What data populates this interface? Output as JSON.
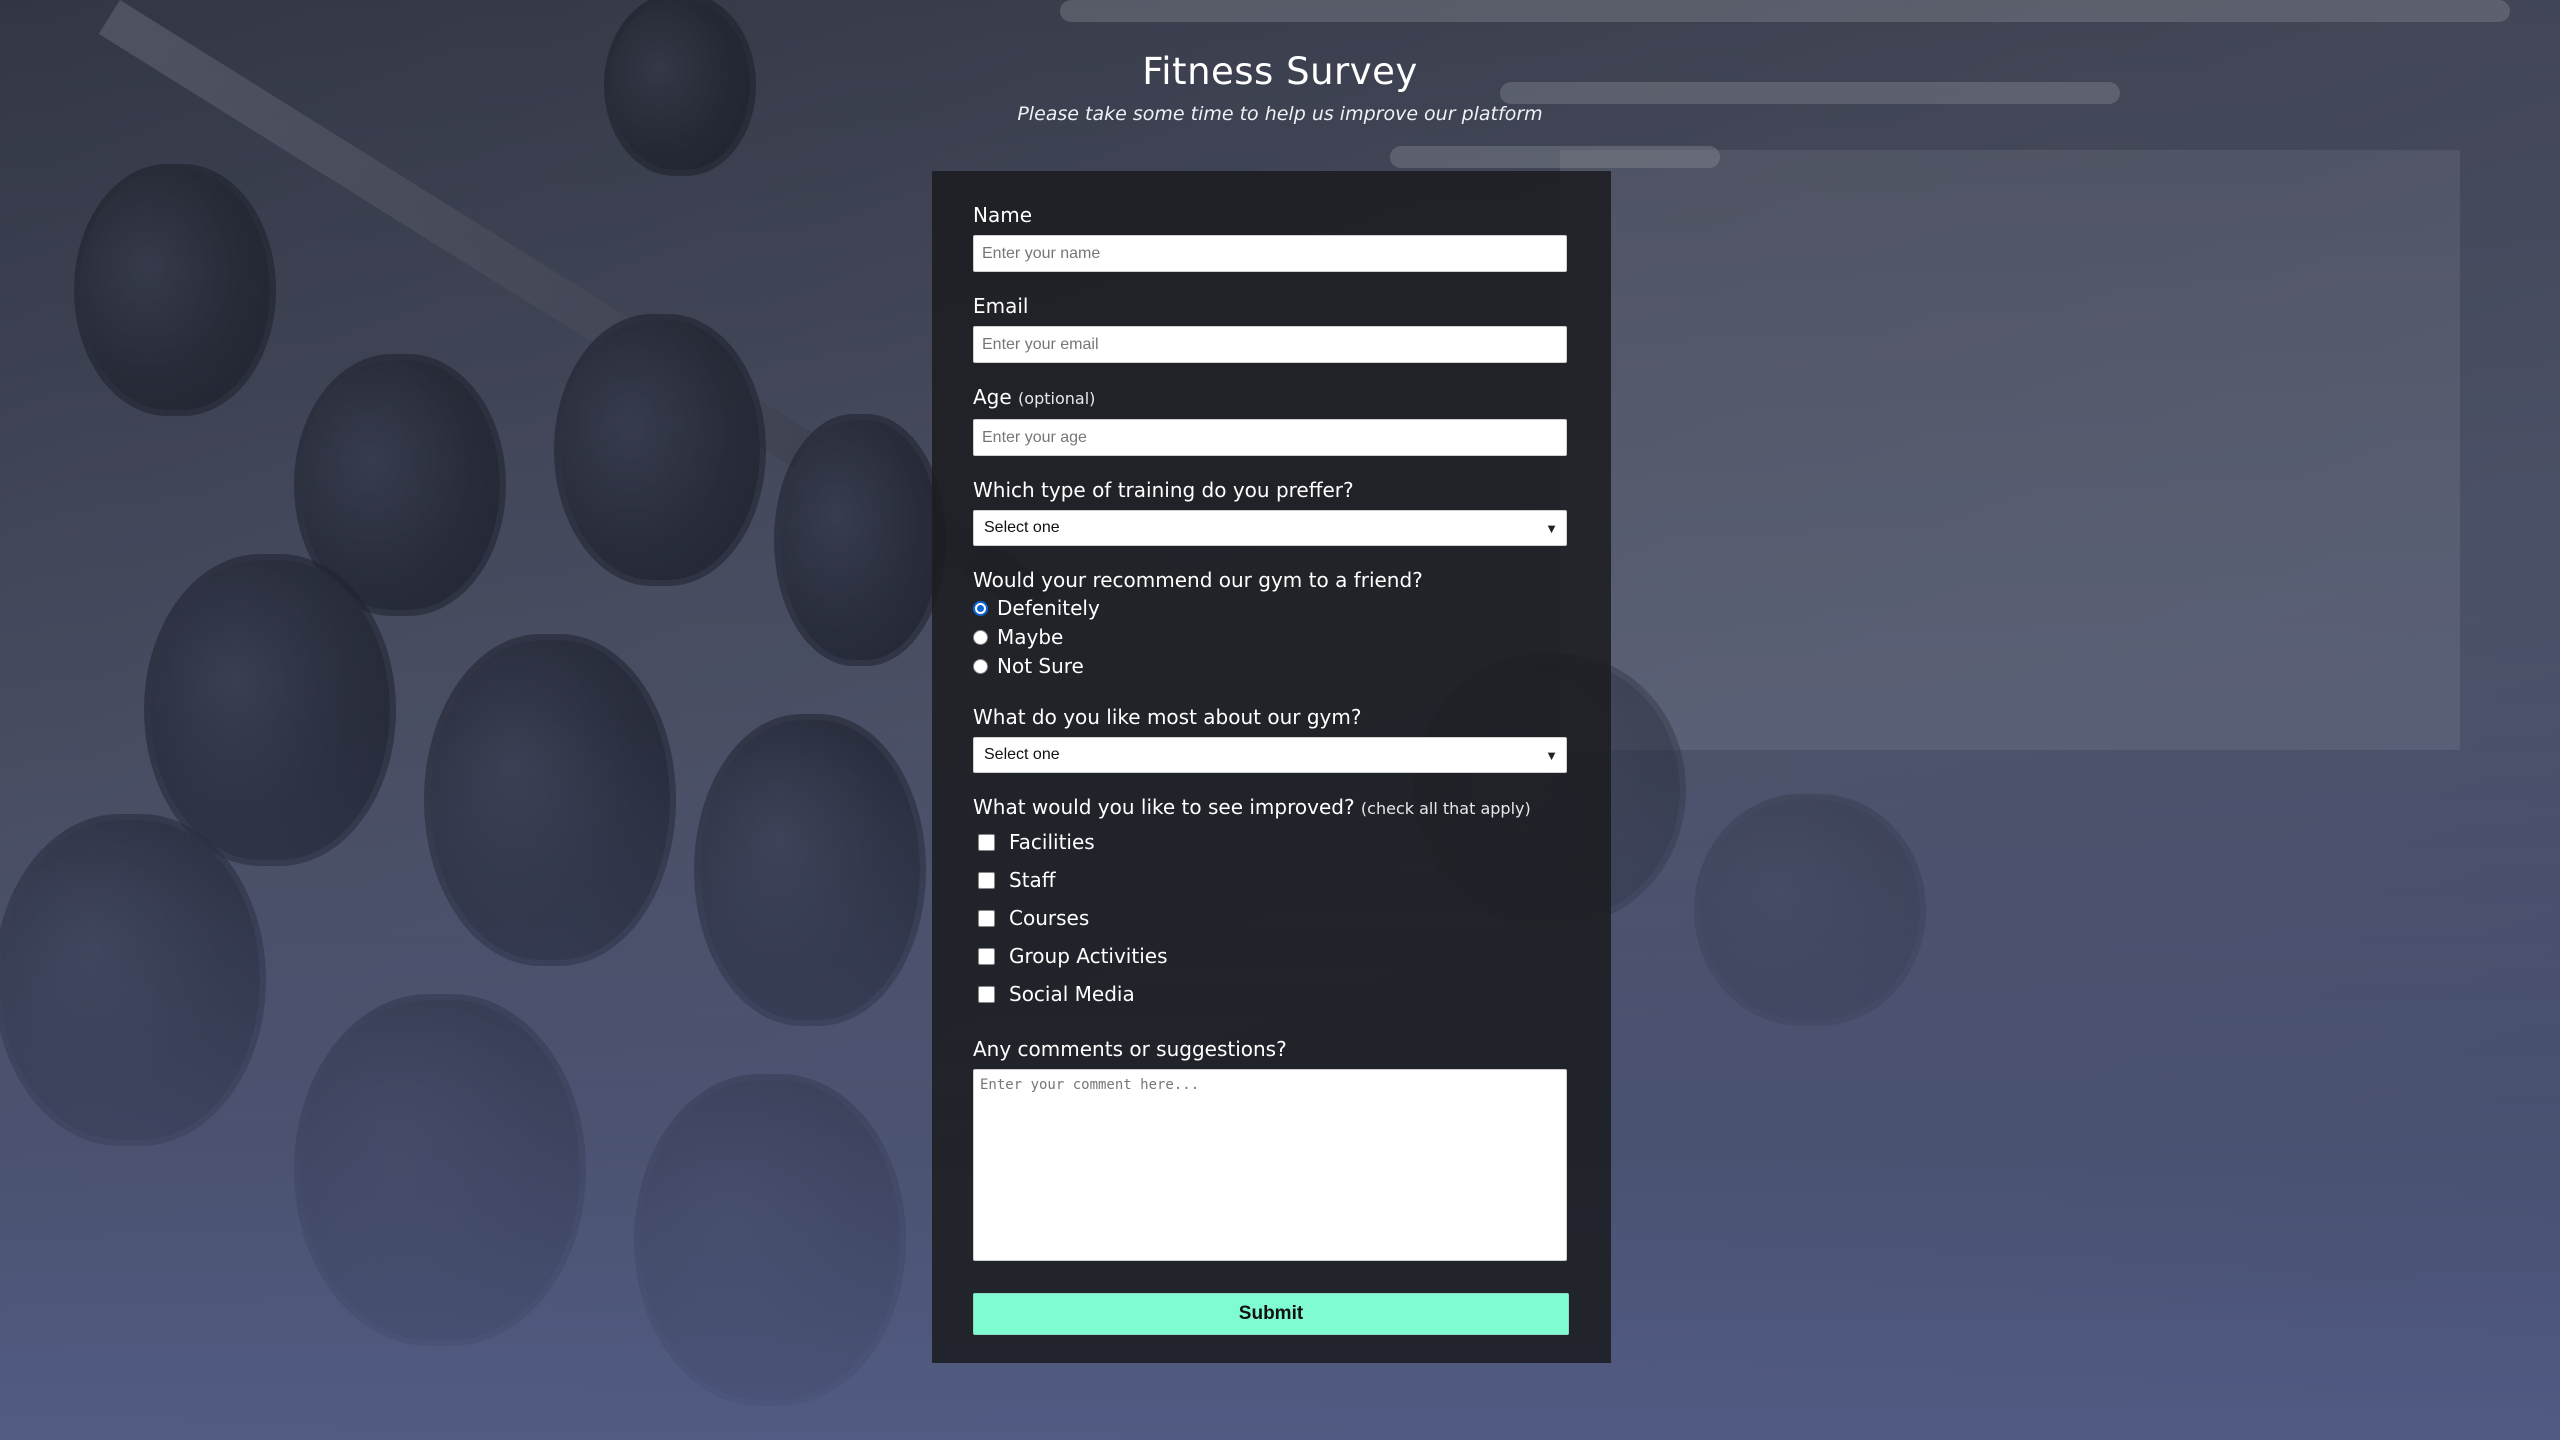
{
  "header": {
    "title": "Fitness Survey",
    "subtitle": "Please take some time to help us improve our platform"
  },
  "form": {
    "name": {
      "label": "Name",
      "placeholder": "Enter your name"
    },
    "email": {
      "label": "Email",
      "placeholder": "Enter your email"
    },
    "age": {
      "label": "Age",
      "hint": "(optional)",
      "placeholder": "Enter your age"
    },
    "training": {
      "label": "Which type of training do you preffer?",
      "selected": "Select one"
    },
    "recommend": {
      "label": "Would your recommend our gym to a friend?",
      "options": [
        "Defenitely",
        "Maybe",
        "Not Sure"
      ],
      "selected_index": 0
    },
    "like_most": {
      "label": "What do you like most about our gym?",
      "selected": "Select one"
    },
    "improve": {
      "label": "What would you like to see improved?",
      "hint": "(check all that apply)",
      "options": [
        "Facilities",
        "Staff",
        "Courses",
        "Group Activities",
        "Social Media"
      ]
    },
    "comments": {
      "label": "Any comments or suggestions?",
      "placeholder": "Enter your comment here..."
    },
    "submit_label": "Submit"
  },
  "colors": {
    "panel_bg": "#1b1c1f",
    "submit_bg": "#7ffcd2",
    "radio_accent": "#0a66d6"
  },
  "icons": {
    "select_chevron": "chevron-down-icon"
  }
}
